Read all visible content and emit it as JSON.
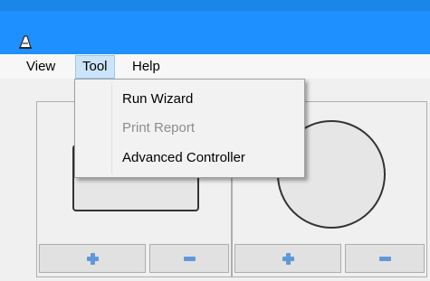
{
  "window": {
    "title_icon": "app-icon"
  },
  "menubar": {
    "items": [
      {
        "label": "View"
      },
      {
        "label": "Tool"
      },
      {
        "label": "Help"
      }
    ]
  },
  "tool_menu": {
    "items": [
      {
        "label": "Run Wizard",
        "enabled": true
      },
      {
        "label": "Print Report",
        "enabled": false
      },
      {
        "label": "Advanced Controller",
        "enabled": true
      }
    ]
  },
  "panels": {
    "left": {
      "shape": "rectangle",
      "add_icon": "plus-icon",
      "remove_icon": "minus-icon"
    },
    "right": {
      "shape": "circle",
      "add_icon": "plus-icon",
      "remove_icon": "minus-icon"
    }
  },
  "colors": {
    "titlebar": "#1e90ff",
    "menu_highlight": "#cce4f7",
    "icon_accent": "#5f98da"
  }
}
